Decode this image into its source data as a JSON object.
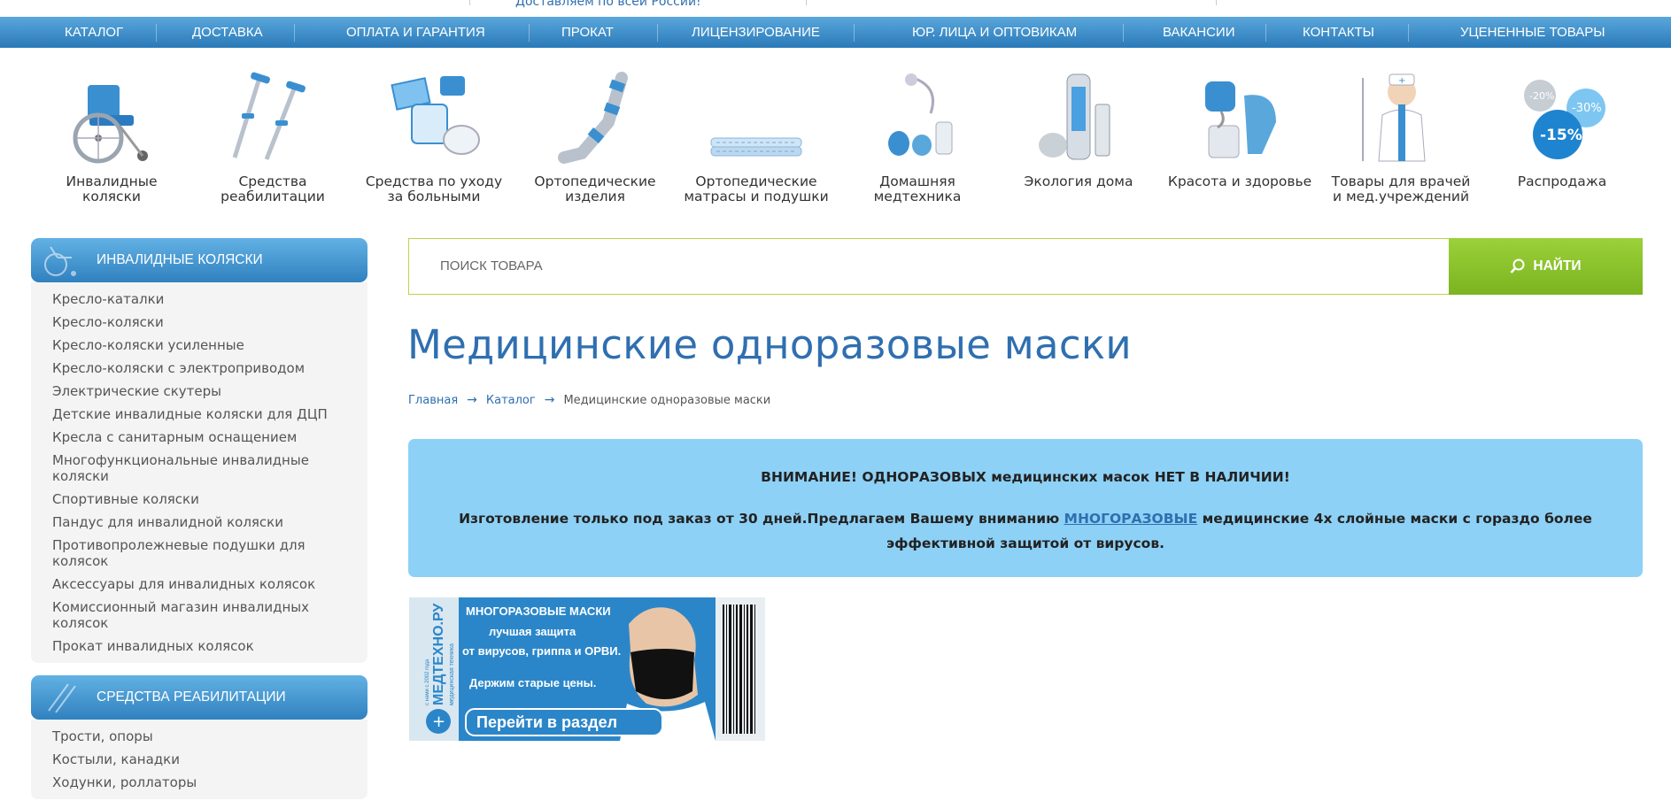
{
  "topstrip": {
    "delivery": "Доставляем по всей России!"
  },
  "nav": [
    "КАТАЛОГ",
    "ДОСТАВКА",
    "ОПЛАТА И ГАРАНТИЯ",
    "ПРОКАТ",
    "ЛИЦЕНЗИРОВАНИЕ",
    "ЮР. ЛИЦА И ОПТОВИКАМ",
    "ВАКАНСИИ",
    "КОНТАКТЫ",
    "УЦЕНЕННЫЕ ТОВАРЫ"
  ],
  "categories": [
    {
      "label": "Инвалидные коляски",
      "icon": "wheelchair-icon"
    },
    {
      "label": "Средства реабилитации",
      "icon": "crutches-icon"
    },
    {
      "label": "Средства по уходу за больными",
      "icon": "care-icon"
    },
    {
      "label": "Ортопедические изделия",
      "icon": "orthosis-icon"
    },
    {
      "label": "Ортопедические матрасы и подушки",
      "icon": "mattress-icon"
    },
    {
      "label": "Домашняя медтехника",
      "icon": "medtech-icon"
    },
    {
      "label": "Экология дома",
      "icon": "air-purifier-icon"
    },
    {
      "label": "Красота и здоровье",
      "icon": "beauty-icon"
    },
    {
      "label": "Товары для врачей и мед.учреждений",
      "icon": "doctor-icon"
    },
    {
      "label": "Распродажа",
      "icon": "sale-icon",
      "badges": [
        "-20%",
        "-30%",
        "-15%"
      ]
    }
  ],
  "sidebar": {
    "section1": {
      "title": "ИНВАЛИДНЫЕ КОЛЯСКИ",
      "items": [
        "Кресло-каталки",
        "Кресло-коляски",
        "Кресло-коляски усиленные",
        "Кресло-коляски с электроприводом",
        "Электрические скутеры",
        "Детские инвалидные коляски для ДЦП",
        "Кресла с санитарным оснащением",
        "Многофункциональные инвалидные коляски",
        "Спортивные коляски",
        "Пандус для инвалидной коляски",
        "Противопролежневые подушки для колясок",
        "Аксессуары для инвалидных колясок",
        "Комиссионный магазин инвалидных колясок",
        "Прокат инвалидных колясок"
      ]
    },
    "section2": {
      "title": "СРЕДСТВА РЕАБИЛИТАЦИИ",
      "items": [
        "Трости, опоры",
        "Костыли, канадки",
        "Ходунки, роллаторы"
      ]
    }
  },
  "search": {
    "placeholder": "ПОИСК ТОВАРА",
    "button": "НАЙТИ"
  },
  "page": {
    "title": "Медицинские одноразовые маски",
    "breadcrumbs": [
      "Главная",
      "Каталог",
      "Медицинские одноразовые маски"
    ]
  },
  "notice": {
    "line1": "ВНИМАНИЕ! ОДНОРАЗОВЫХ медицинских масок НЕТ В НАЛИЧИИ!",
    "line2_before": "Изготовление только под заказ от 30 дней.Предлагаем Вашему вниманию ",
    "line2_link": "МНОГОРАЗОВЫЕ",
    "line2_after": " медицинские 4х слойные маски с гораздо более эффективной защитой от вирусов."
  },
  "banner": {
    "brand": "МЕДТЕХНО.РУ",
    "brand_sub": "медицинская техника",
    "since": "с нами с 2002 года",
    "line1": "МНОГОРАЗОВЫЕ МАСКИ",
    "line2": "лучшая защита",
    "line3": "от вирусов, гриппа и ОРВИ.",
    "line4": "Держим старые цены.",
    "cta": "Перейти в раздел"
  },
  "colors": {
    "nav": "#2a7ab8",
    "title": "#2f6fb0",
    "search_btn": "#8cc22c",
    "notice_bg": "#8ed1f6"
  }
}
